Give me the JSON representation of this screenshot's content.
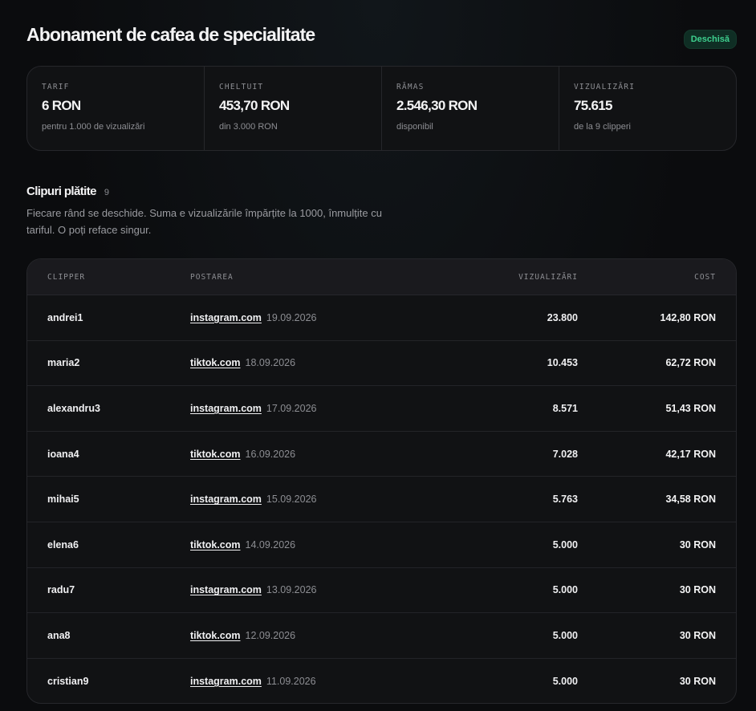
{
  "header": {
    "title": "Abonament de cafea de specialitate",
    "status": "Deschisă",
    "status_color": "#3ecf8e"
  },
  "stats": [
    {
      "label": "TARIF",
      "value": "6 RON",
      "sub": "pentru 1.000 de vizualizări"
    },
    {
      "label": "CHELTUIT",
      "value": "453,70 RON",
      "sub": "din 3.000 RON"
    },
    {
      "label": "RĂMAS",
      "value": "2.546,30 RON",
      "sub": "disponibil"
    },
    {
      "label": "VIZUALIZĂRI",
      "value": "75.615",
      "sub": "de la 9 clipperi"
    }
  ],
  "section": {
    "title": "Clipuri plătite",
    "count": "9",
    "description": "Fiecare rând se deschide. Suma e vizualizările împărțite la 1000, înmulțite cu tariful. O poți reface singur."
  },
  "table": {
    "headers": {
      "clipper": "CLIPPER",
      "post": "POSTAREA",
      "views": "VIZUALIZĂRI",
      "cost": "COST"
    },
    "rows": [
      {
        "clipper": "andrei1",
        "platform": "instagram.com",
        "date": "19.09.2026",
        "views": "23.800",
        "cost": "142,80 RON"
      },
      {
        "clipper": "maria2",
        "platform": "tiktok.com",
        "date": "18.09.2026",
        "views": "10.453",
        "cost": "62,72 RON"
      },
      {
        "clipper": "alexandru3",
        "platform": "instagram.com",
        "date": "17.09.2026",
        "views": "8.571",
        "cost": "51,43 RON"
      },
      {
        "clipper": "ioana4",
        "platform": "tiktok.com",
        "date": "16.09.2026",
        "views": "7.028",
        "cost": "42,17 RON"
      },
      {
        "clipper": "mihai5",
        "platform": "instagram.com",
        "date": "15.09.2026",
        "views": "5.763",
        "cost": "34,58 RON"
      },
      {
        "clipper": "elena6",
        "platform": "tiktok.com",
        "date": "14.09.2026",
        "views": "5.000",
        "cost": "30 RON"
      },
      {
        "clipper": "radu7",
        "platform": "instagram.com",
        "date": "13.09.2026",
        "views": "5.000",
        "cost": "30 RON"
      },
      {
        "clipper": "ana8",
        "platform": "tiktok.com",
        "date": "12.09.2026",
        "views": "5.000",
        "cost": "30 RON"
      },
      {
        "clipper": "cristian9",
        "platform": "instagram.com",
        "date": "11.09.2026",
        "views": "5.000",
        "cost": "30 RON"
      }
    ]
  }
}
